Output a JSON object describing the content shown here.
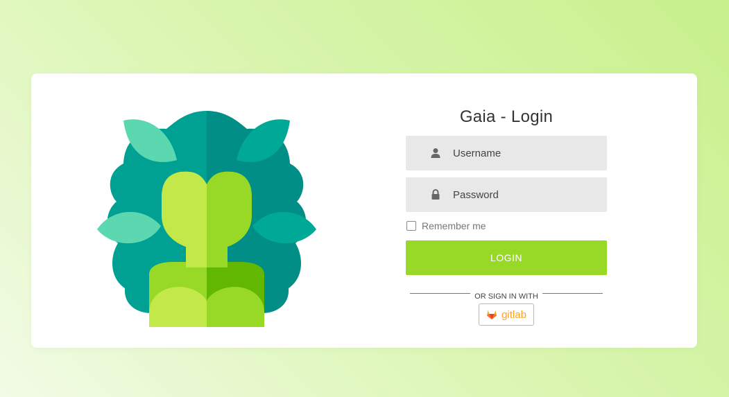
{
  "login": {
    "title": "Gaia - Login",
    "username_placeholder": "Username",
    "password_placeholder": "Password",
    "remember_label": "Remember me",
    "login_button": "LOGIN",
    "divider_text": "OR SIGN IN WITH",
    "provider_label": "gitlab"
  },
  "icons": {
    "logo": "gaia-leaf-person-logo",
    "username": "user-icon",
    "password": "lock-icon",
    "provider": "gitlab-icon"
  },
  "colors": {
    "accent": "#97d926",
    "provider": "#fca326",
    "field_bg": "#e8e8e8"
  }
}
